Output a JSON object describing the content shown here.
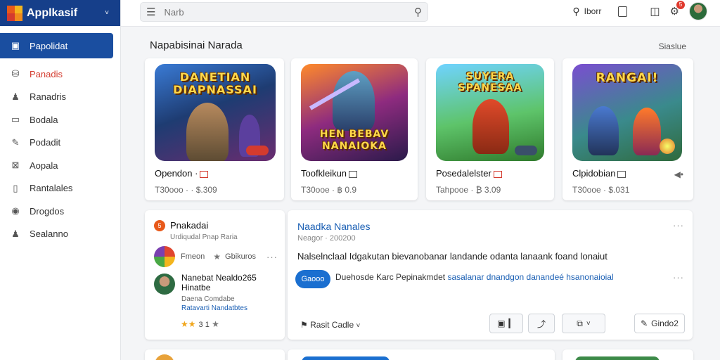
{
  "brand": {
    "title": "Applkasif",
    "chevron": "˅"
  },
  "sidebar": {
    "items": [
      {
        "label": "Papolidat",
        "icon": "calendar-icon",
        "glyph": "▣"
      },
      {
        "label": "Panadis",
        "icon": "bag-icon",
        "glyph": "⛁"
      },
      {
        "label": "Ranadris",
        "icon": "users-icon",
        "glyph": "♟"
      },
      {
        "label": "Bodala",
        "icon": "chat-icon",
        "glyph": "▭"
      },
      {
        "label": "Podadit",
        "icon": "pen-icon",
        "glyph": "✎"
      },
      {
        "label": "Aopala",
        "icon": "image-icon",
        "glyph": "⊠"
      },
      {
        "label": "Rantalales",
        "icon": "document-icon",
        "glyph": "▯"
      },
      {
        "label": "Drogdos",
        "icon": "compass-icon",
        "glyph": "◉"
      },
      {
        "label": "Sealanno",
        "icon": "person-icon",
        "glyph": "♟"
      }
    ]
  },
  "search": {
    "placeholder": "Narb"
  },
  "topbar": {
    "search_label": "Iborr",
    "notif_count": "5"
  },
  "section": {
    "title": "Napabisinai Narada",
    "link": "Siaslue"
  },
  "games": [
    {
      "art_title": "DANETIAN DIAPNASSAI",
      "name": "Opendon ·",
      "sub": "T30ooo · · $.309"
    },
    {
      "art_title": "HEN BEBAV NANAIOKA",
      "name": "Toofkleikun",
      "sub": "T30ooe · ฿ 0.9"
    },
    {
      "art_title": "SUYERA SPANESAA",
      "name": "Posedalelster",
      "sub": "Tahpooe · ₿ 3.09"
    },
    {
      "art_title": "RANGAI!",
      "name": "Clpidobian",
      "sub": "T30ooe · $.031"
    }
  ],
  "review_card": {
    "badge": "5",
    "title": "Pnakadai",
    "subtitle": "Urdiqudal Pnap Raria",
    "row_label": "Fmeon",
    "row_value": "Gbikuros",
    "person_name": "Nanebat Nealdo265 Hinatbe",
    "person_role": "Daena Comdabe",
    "person_link": "Ratavarti Nandatbtes",
    "rating": "3 1"
  },
  "main_card": {
    "title": "Naadka Nanales",
    "subtitle": "Neagor · 200200",
    "body": "Nalselnclaal Idgakutan bievanobanar landande odanta lanaank foand lonaiut",
    "pill": "Gaooo",
    "link_text": "Duehosde Karc Pepinakmdet",
    "link_blue": "sasalanar dnandgon danandeé hsanonaioial",
    "footer_label": "Rasit Cadle",
    "btn_b": "Gindo2"
  },
  "colors": {
    "brand": "#163f8a",
    "active": "#1a4ea0",
    "link": "#1a5fb4",
    "accent_red": "#d43b2e"
  }
}
